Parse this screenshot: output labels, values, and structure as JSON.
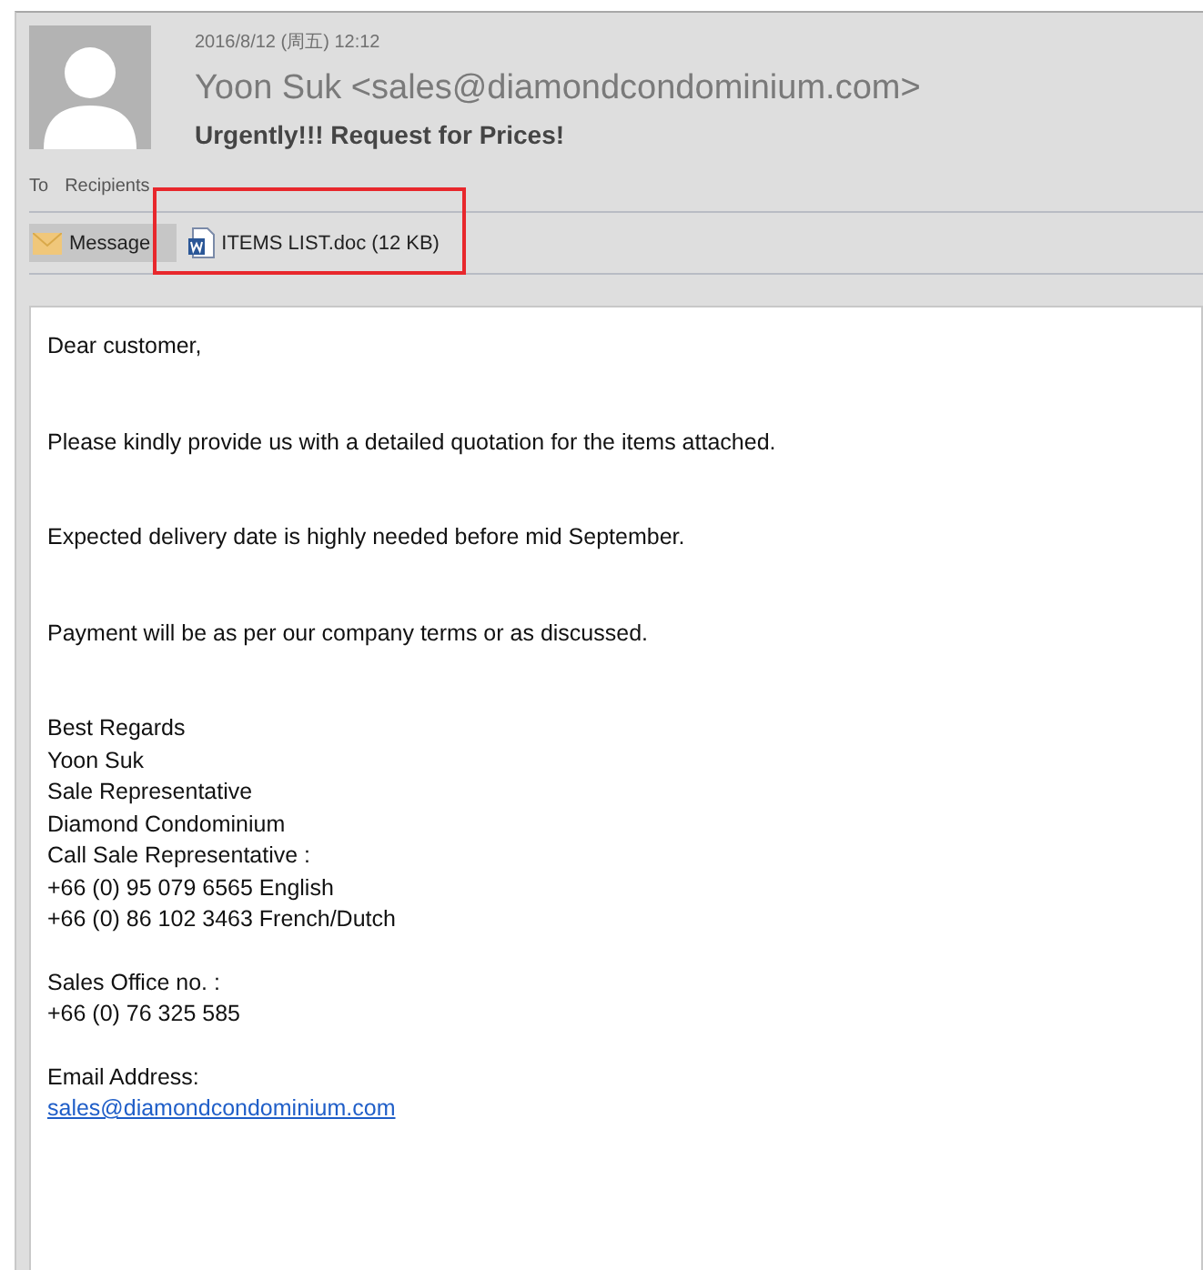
{
  "header": {
    "date": "2016/8/12 (周五) 12:12",
    "sender": "Yoon Suk <sales@diamondcondominium.com>",
    "subject": "Urgently!!! Request for Prices!",
    "to_label": "To",
    "to_value": "Recipients"
  },
  "attachments": [
    {
      "kind": "message",
      "label": "Message",
      "selected": true,
      "highlighted": false
    },
    {
      "kind": "word",
      "label": "ITEMS LIST.doc (12 KB)",
      "selected": false,
      "highlighted": true
    }
  ],
  "body": [
    {
      "lines": [
        {
          "kind": "text",
          "text": "Dear customer,"
        }
      ]
    },
    {
      "lines": [
        {
          "kind": "text",
          "text": "Please kindly provide us with a detailed quotation for the items attached."
        }
      ]
    },
    {
      "lines": [
        {
          "kind": "text",
          "text": "Expected delivery date is highly needed before mid September."
        }
      ]
    },
    {
      "lines": [
        {
          "kind": "text",
          "text": "Payment will be as per our company terms or as discussed."
        }
      ]
    },
    {
      "lines": [
        {
          "kind": "text",
          "text": "Best Regards"
        },
        {
          "kind": "text",
          "text": "Yoon Suk"
        },
        {
          "kind": "text",
          "text": "Sale Representative"
        },
        {
          "kind": "text",
          "text": "Diamond Condominium"
        },
        {
          "kind": "text",
          "text": "Call Sale Representative :"
        },
        {
          "kind": "text",
          "text": "+66 (0) 95 079 6565 English"
        },
        {
          "kind": "text",
          "text": "+66 (0) 86 102 3463 French/Dutch"
        }
      ]
    },
    {
      "lines": [
        {
          "kind": "text",
          "text": "Sales Office no. :"
        },
        {
          "kind": "text",
          "text": "+66 (0) 76 325 585"
        }
      ]
    },
    {
      "lines": [
        {
          "kind": "text",
          "text": "Email Address:"
        },
        {
          "kind": "link",
          "text": "sales@diamondcondominium.com"
        }
      ]
    }
  ]
}
